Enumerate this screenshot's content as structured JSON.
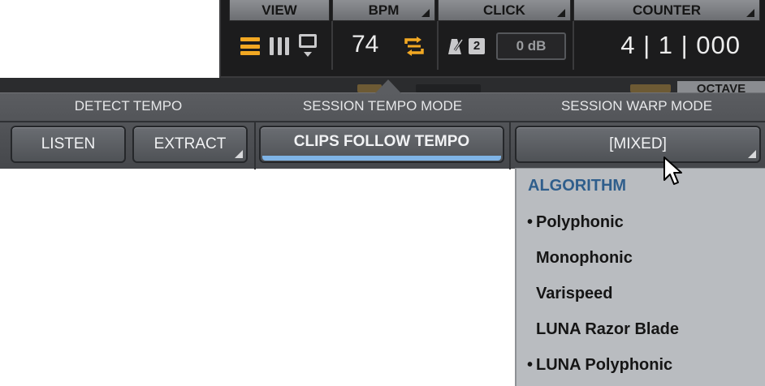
{
  "transport": {
    "view": {
      "label": "VIEW"
    },
    "bpm": {
      "label": "BPM",
      "value": "74"
    },
    "click": {
      "label": "CLICK",
      "count_badge": "2",
      "level": "0 dB"
    },
    "counter": {
      "label": "COUNTER",
      "value": "4 | 1 | 000"
    }
  },
  "partial_tab": {
    "label": "OCTAVE"
  },
  "panel": {
    "detect_tempo": {
      "label": "DETECT TEMPO",
      "listen": "LISTEN",
      "extract": "EXTRACT"
    },
    "session_tempo_mode": {
      "label": "SESSION TEMPO MODE",
      "value": "CLIPS FOLLOW TEMPO"
    },
    "session_warp_mode": {
      "label": "SESSION WARP MODE",
      "value": "[MIXED]"
    }
  },
  "menu": {
    "header": "ALGORITHM",
    "items": [
      {
        "label": "Polyphonic",
        "bullet": "•"
      },
      {
        "label": "Monophonic",
        "bullet": ""
      },
      {
        "label": "Varispeed",
        "bullet": ""
      },
      {
        "label": "LUNA Razor Blade",
        "bullet": ""
      },
      {
        "label": "LUNA Polyphonic",
        "bullet": "•"
      }
    ]
  },
  "colors": {
    "accent_orange": "#f2a823",
    "active_blue": "#7fb4e6",
    "menu_header_blue": "#2f5e8c"
  },
  "icons": [
    "rows-view-icon",
    "columns-view-icon",
    "screen-view-icon",
    "tempo-follow-icon",
    "metronome-icon",
    "pointer-cursor-icon"
  ]
}
